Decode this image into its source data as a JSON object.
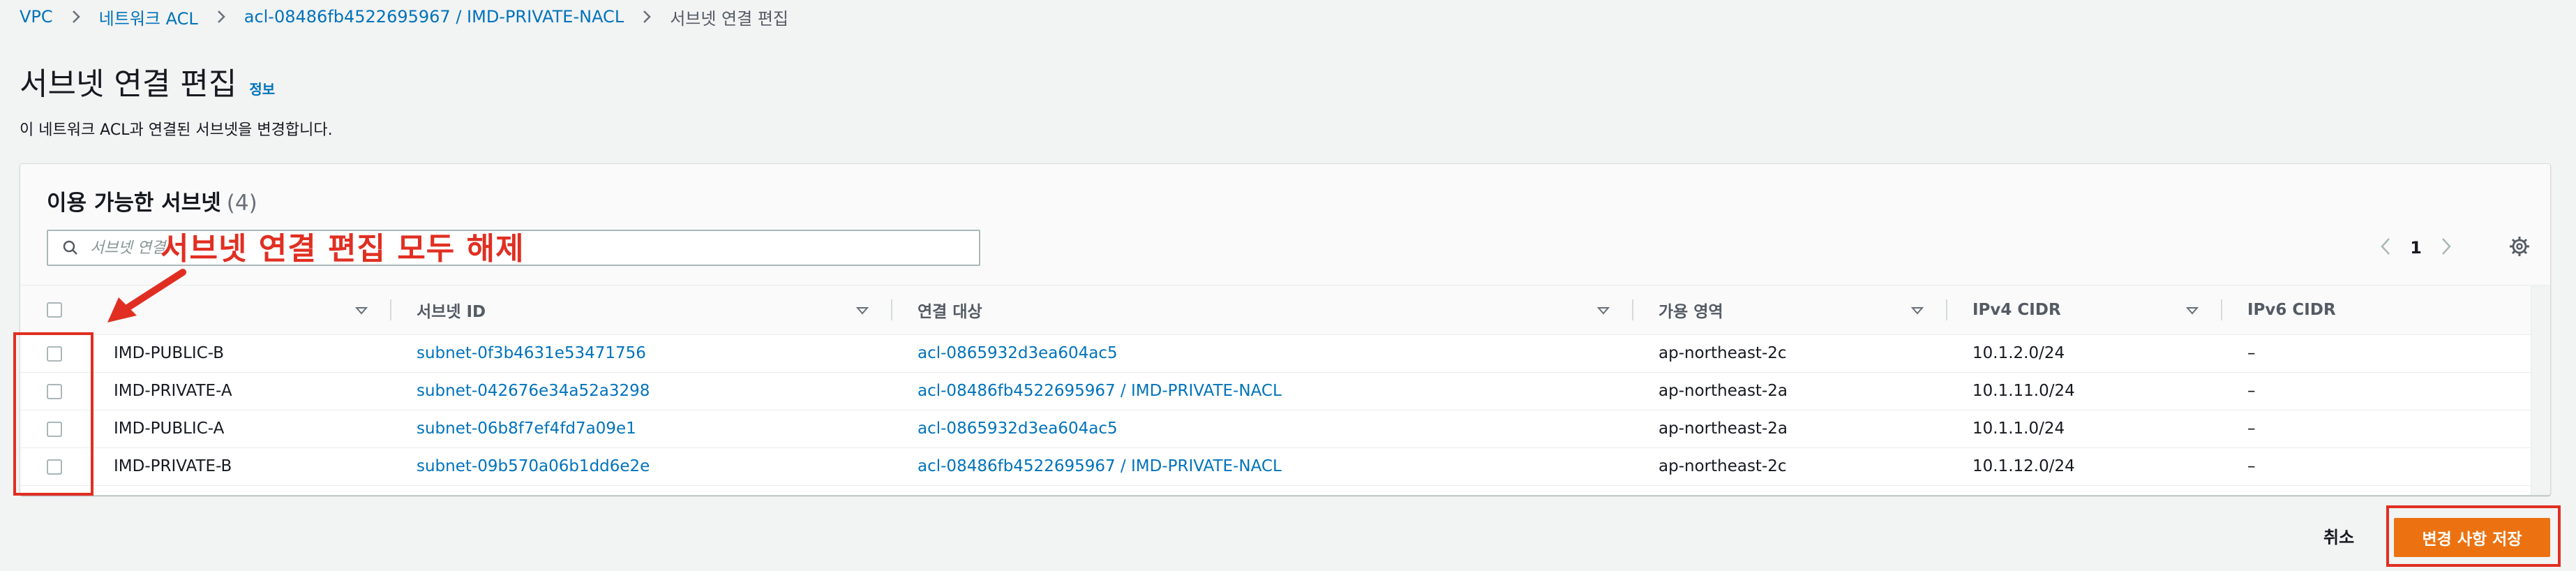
{
  "breadcrumb": {
    "items": [
      "VPC",
      "네트워크 ACL",
      "acl-08486fb4522695967 / IMD-PRIVATE-NACL",
      "서브넷 연결 편집"
    ]
  },
  "page": {
    "title": "서브넷 연결 편집",
    "info_label": "정보",
    "description": "이 네트워크 ACL과 연결된 서브넷을 변경합니다."
  },
  "panel": {
    "title": "이용 가능한 서브넷",
    "count": "(4)",
    "search_placeholder": "서브넷 연결",
    "page_number": "1"
  },
  "table": {
    "columns": [
      "",
      "서브넷 ID",
      "연결 대상",
      "가용 영역",
      "IPv4 CIDR",
      "IPv6 CIDR"
    ],
    "rows": [
      {
        "name": "IMD-PUBLIC-B",
        "subnet_id": "subnet-0f3b4631e53471756",
        "associated_with": "acl-0865932d3ea604ac5",
        "az": "ap-northeast-2c",
        "ipv4": "10.1.2.0/24",
        "ipv6": "–"
      },
      {
        "name": "IMD-PRIVATE-A",
        "subnet_id": "subnet-042676e34a52a3298",
        "associated_with": "acl-08486fb4522695967 / IMD-PRIVATE-NACL",
        "az": "ap-northeast-2a",
        "ipv4": "10.1.11.0/24",
        "ipv6": "–"
      },
      {
        "name": "IMD-PUBLIC-A",
        "subnet_id": "subnet-06b8f7ef4fd7a09e1",
        "associated_with": "acl-0865932d3ea604ac5",
        "az": "ap-northeast-2a",
        "ipv4": "10.1.1.0/24",
        "ipv6": "–"
      },
      {
        "name": "IMD-PRIVATE-B",
        "subnet_id": "subnet-09b570a06b1dd6e2e",
        "associated_with": "acl-08486fb4522695967 / IMD-PRIVATE-NACL",
        "az": "ap-northeast-2c",
        "ipv4": "10.1.12.0/24",
        "ipv6": "–"
      }
    ]
  },
  "annotation": {
    "label": "서브넷 연결 편집 모두 해제",
    "color": "#e02f22"
  },
  "footer": {
    "cancel_label": "취소",
    "save_label": "변경 사항 저장"
  },
  "colors": {
    "link": "#0073bb",
    "primary_button": "#ec7211",
    "background": "#f2f3f3"
  }
}
